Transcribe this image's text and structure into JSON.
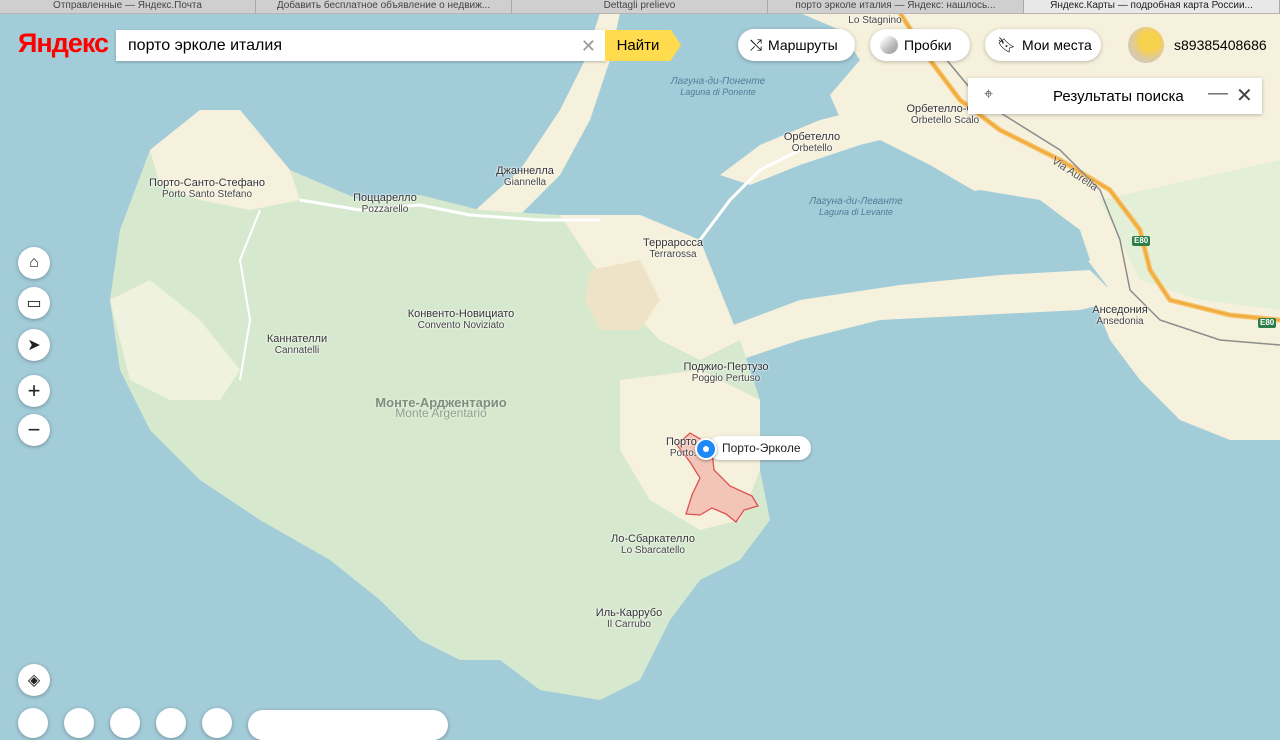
{
  "browser": {
    "tabs": [
      {
        "label": "Отправленные — Яндекс.Почта",
        "active": false
      },
      {
        "label": "Добавить бесплатное объявление о недвиж...",
        "active": false
      },
      {
        "label": "Dettagli prelievo",
        "active": false
      },
      {
        "label": "порто эрколе италия — Яндекс: нашлось...",
        "active": false
      },
      {
        "label": "Яндекс.Карты — подробная карта России...",
        "active": true
      }
    ]
  },
  "header": {
    "logo": "Яндекс",
    "search_value": "порто эрколе италия",
    "find_label": "Найти",
    "routes_label": "Маршруты",
    "traffic_label": "Пробки",
    "my_places_label": "Мои места",
    "username": "s89385408686"
  },
  "results_panel": {
    "title": "Результаты поиска"
  },
  "map": {
    "labels": {
      "porto_santo_stefano": {
        "ru": "Порто-Санто-Стефано",
        "it": "Porto Santo Stefano"
      },
      "pozzarello": {
        "ru": "Поццарелло",
        "it": "Pozzarello"
      },
      "giannella": {
        "ru": "Джаннелла",
        "it": "Giannella"
      },
      "laguna_ponente": {
        "ru": "Лагуна-ди-Поненте",
        "it": "Laguna di Ponente"
      },
      "orbetello": {
        "ru": "Орбетелло",
        "it": "Orbetello"
      },
      "orbetello_scalo": {
        "ru": "Орбетелло-С...",
        "it": "Orbetello Scalo"
      },
      "laguna_levante": {
        "ru": "Лагуна-ди-Леванте",
        "it": "Laguna di Levante"
      },
      "terrarossa": {
        "ru": "Терраросса",
        "it": "Terrarossa"
      },
      "convento": {
        "ru": "Конвенто-Новициато",
        "it": "Convento Noviziato"
      },
      "cannatelli": {
        "ru": "Каннателли",
        "it": "Cannatelli"
      },
      "monte_argentario": {
        "ru": "Монте-Арджентарио",
        "it": "Monte Argentario"
      },
      "poggio_pertuso": {
        "ru": "Поджио-Пертузо",
        "it": "Poggio Pertuso"
      },
      "porto_ercole_small": {
        "ru": "Порто...",
        "it": "Porto..."
      },
      "lo_sbarcatello": {
        "ru": "Ло-Сбаркателло",
        "it": "Lo Sbarcatello"
      },
      "il_carrubo": {
        "ru": "Иль-Каррубо",
        "it": "Il Carrubo"
      },
      "ansedonia": {
        "ru": "Анседония",
        "it": "Ansedonia"
      },
      "lo_stagnino": {
        "ru": "",
        "it": "Lo Stagnino"
      }
    },
    "road_name": "Via Aurelia",
    "shields": [
      "E80",
      "E80"
    ],
    "marker_label": "Порто-Эрколе"
  },
  "icons": {
    "home": "home-icon",
    "briefcase": "briefcase-icon",
    "location": "locate-icon",
    "zoom_in": "plus-icon",
    "zoom_out": "minus-icon",
    "layers": "layers-icon"
  }
}
